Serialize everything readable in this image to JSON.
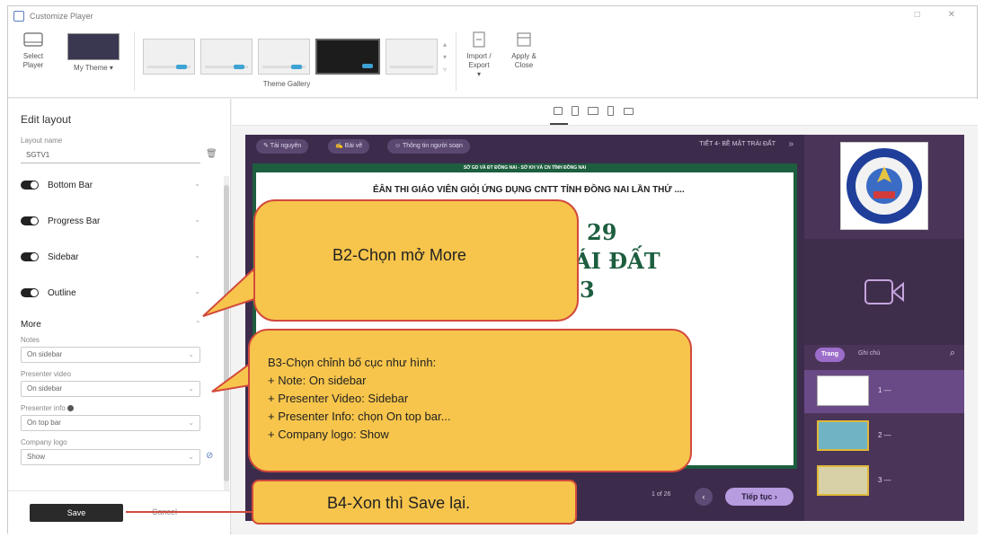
{
  "window": {
    "title": "Customize Player"
  },
  "ribbon": {
    "select_player": "Select Player",
    "my_theme": "My Theme ▾",
    "theme_gallery": "Theme Gallery",
    "import_export": "Import / Export",
    "apply_close": "Apply & Close"
  },
  "left_panel": {
    "title": "Edit layout",
    "layout_name_label": "Layout name",
    "layout_name_value": "SGTV1",
    "toggles": [
      "Bottom Bar",
      "Progress Bar",
      "Sidebar",
      "Outline"
    ],
    "more": "More",
    "notes_label": "Notes",
    "notes_value": "On sidebar",
    "presenter_video_label": "Presenter video",
    "presenter_video_value": "On sidebar",
    "presenter_info_label": "Presenter info",
    "presenter_info_value": "On top bar",
    "company_logo_label": "Company logo",
    "company_logo_value": "Show",
    "save": "Save",
    "cancel": "Cancel"
  },
  "player": {
    "pills": [
      "Tài nguyên",
      "Bài vẽ",
      "Thông tin người soạn"
    ],
    "lesson_title": "TIẾT 4- BỀ MẶT TRÁI ĐẤT",
    "slide_header": "SỞ GD VÀ ĐT ĐỒNG NAI - SỞ KH VÀ CN TỈNH ĐỒNG NAI",
    "slide_line": "ẺÂN THI GIÁO VIÊN GIỎỊ ỨNG DỤNG CNTT TỈNH ĐỒNG NAI LẦN THỨ ....",
    "slide_num": "29",
    "slide_word": "RÁI ĐẤT",
    "slide_three": "3",
    "pager": "1 of 26",
    "next": "Tiếp tục",
    "tab_active": "Trang",
    "tab_notes": "Ghi chú",
    "outline": [
      "1 —",
      "2 —",
      "3 —"
    ]
  },
  "callouts": {
    "b2": "B2-Chọn  mở More",
    "b3_title": "B3-Chọn chỉnh bố cục như hình:",
    "b3_lines": [
      "+ Note: On sidebar",
      "+ Presenter Video: Sidebar",
      "+ Presenter Info: chọn On top bar...",
      "+ Company logo: Show"
    ],
    "b4": "B4-Xon thì Save lại."
  },
  "colors": {
    "player_bg": "#3d2b4c",
    "sidebar_bg": "#4a3558",
    "slide_border": "#1d5e3f",
    "callout_fill": "#f7c54c",
    "callout_border": "#d24a3c"
  }
}
